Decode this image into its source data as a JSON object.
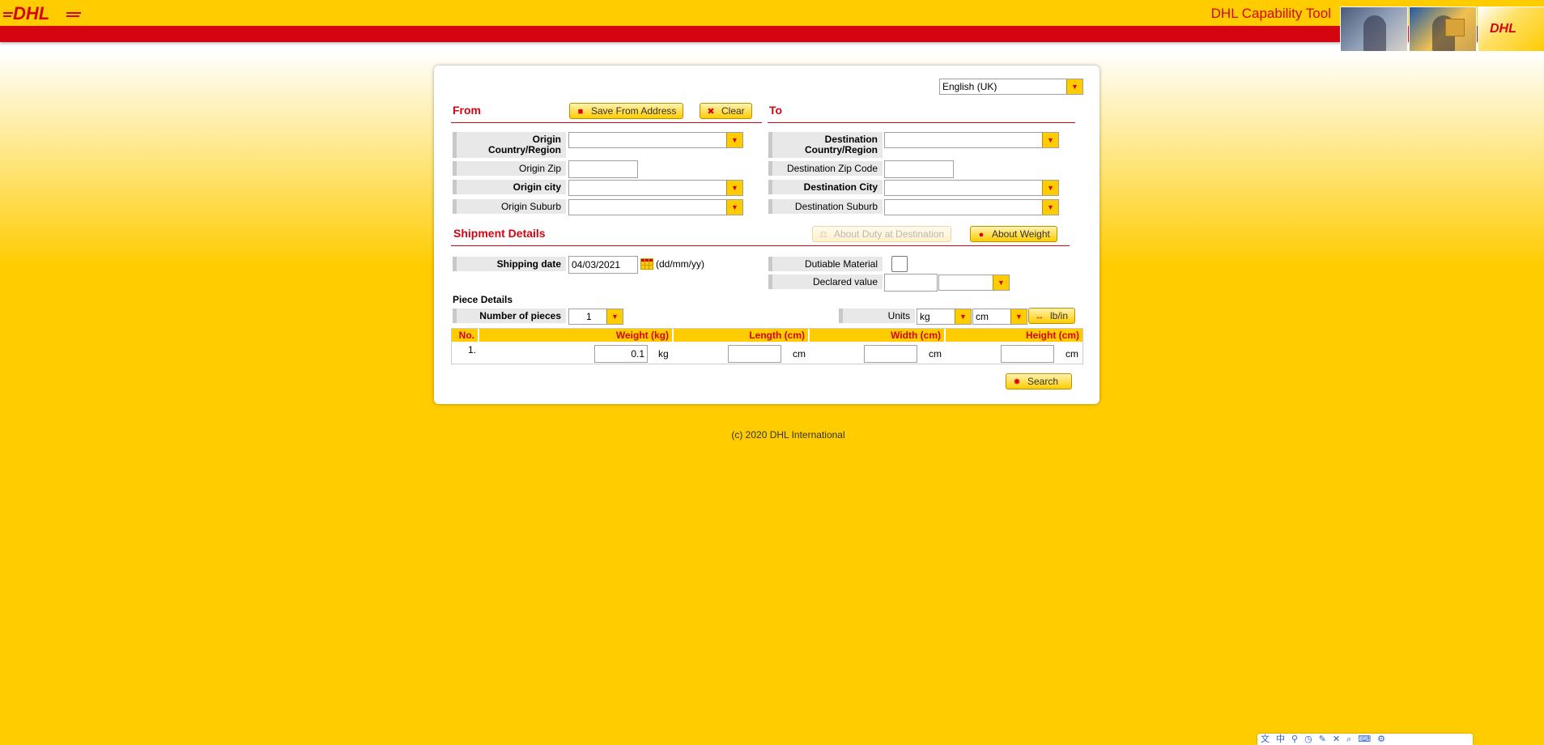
{
  "header": {
    "logo_text": "DHL",
    "app_title": "DHL Capability Tool"
  },
  "language": {
    "selected": "English (UK)"
  },
  "from_section": {
    "title": "From",
    "save_button": "Save From Address",
    "clear_button": "Clear",
    "origin_country_label_line1": "Origin",
    "origin_country_label_line2": "Country/Region",
    "origin_country_value": "",
    "origin_zip_label": "Origin Zip",
    "origin_zip_value": "",
    "origin_city_label": "Origin city",
    "origin_city_value": "",
    "origin_suburb_label": "Origin Suburb",
    "origin_suburb_value": ""
  },
  "to_section": {
    "title": "To",
    "dest_country_label_line1": "Destination",
    "dest_country_label_line2": "Country/Region",
    "dest_country_value": "",
    "dest_zip_label": "Destination Zip Code",
    "dest_zip_value": "",
    "dest_city_label": "Destination City",
    "dest_city_value": "",
    "dest_suburb_label": "Destination Suburb",
    "dest_suburb_value": ""
  },
  "shipment": {
    "title": "Shipment Details",
    "about_duty_button": "About Duty at Destination",
    "about_weight_button": "About Weight",
    "shipping_date_label": "Shipping date",
    "shipping_date_value": "04/03/2021",
    "date_format_hint": "(dd/mm/yy)",
    "dutiable_label": "Dutiable Material",
    "dutiable_checked": false,
    "declared_value_label": "Declared value",
    "declared_value": "",
    "declared_currency": ""
  },
  "pieces": {
    "title": "Piece Details",
    "number_label": "Number of pieces",
    "number_value": "1",
    "units_label": "Units",
    "weight_unit": "kg",
    "dim_unit": "cm",
    "toggle_button": "lb/in",
    "columns": [
      "No.",
      "Weight (kg)",
      "Length (cm)",
      "Width (cm)",
      "Height (cm)"
    ],
    "rows": [
      {
        "no": "1.",
        "weight": "0.1",
        "weight_unit": "kg",
        "length": "",
        "length_unit": "cm",
        "width": "",
        "width_unit": "cm",
        "height": "",
        "height_unit": "cm"
      }
    ]
  },
  "search_button": "Search",
  "footer": "(c) 2020 DHL International",
  "colors": {
    "dhl_yellow": "#ffcc00",
    "dhl_red": "#d40511"
  }
}
